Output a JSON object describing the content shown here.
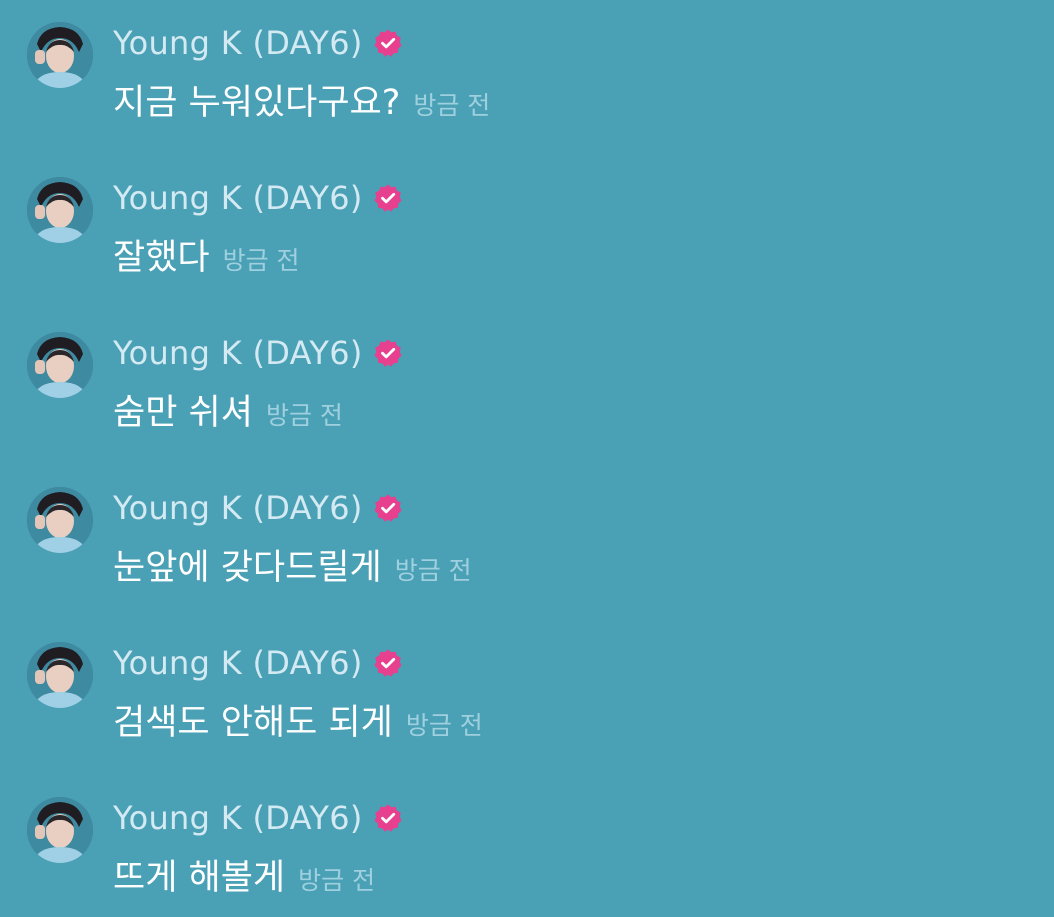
{
  "messages": [
    {
      "sender": "Young K (DAY6)",
      "avatar_icon": "profile-photo",
      "verified_icon": "verified-badge-icon",
      "text": "지금 누워있다구요?",
      "time": "방금 전"
    },
    {
      "sender": "Young K (DAY6)",
      "avatar_icon": "profile-photo",
      "verified_icon": "verified-badge-icon",
      "text": "잘했다",
      "time": "방금 전"
    },
    {
      "sender": "Young K (DAY6)",
      "avatar_icon": "profile-photo",
      "verified_icon": "verified-badge-icon",
      "text": "숨만 쉬셔",
      "time": "방금 전"
    },
    {
      "sender": "Young K (DAY6)",
      "avatar_icon": "profile-photo",
      "verified_icon": "verified-badge-icon",
      "text": "눈앞에 갖다드릴게",
      "time": "방금 전"
    },
    {
      "sender": "Young K (DAY6)",
      "avatar_icon": "profile-photo",
      "verified_icon": "verified-badge-icon",
      "text": "검색도 안해도 되게",
      "time": "방금 전"
    },
    {
      "sender": "Young K (DAY6)",
      "avatar_icon": "profile-photo",
      "verified_icon": "verified-badge-icon",
      "text": "뜨게 해볼게",
      "time": "방금 전"
    }
  ],
  "colors": {
    "background": "#4aa0b5",
    "sender_name": "#d3eaf2",
    "message_text": "#ffffff",
    "timestamp": "#9fd0df",
    "verified_badge": "#e6408f"
  }
}
